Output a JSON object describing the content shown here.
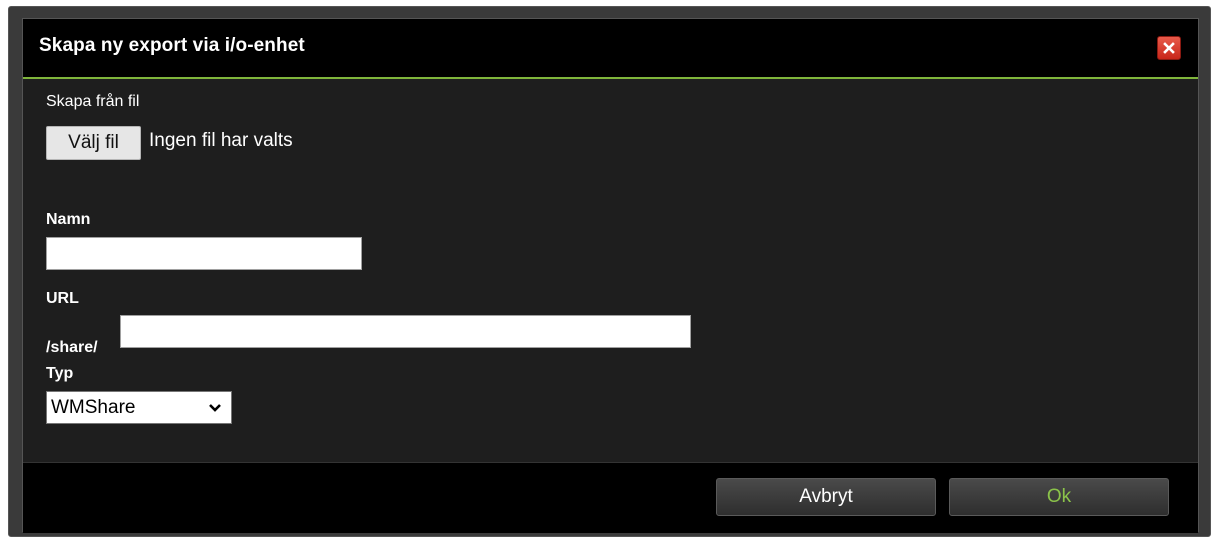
{
  "dialog": {
    "title": "Skapa ny export via i/o-enhet",
    "close_icon": "close-icon"
  },
  "form": {
    "from_file_label": "Skapa från fil",
    "file_button_label": "Välj fil",
    "file_status": "Ingen fil har valts",
    "name_label": "Namn",
    "name_value": "",
    "url_label": "URL",
    "url_prefix": "/share/",
    "url_value": "",
    "type_label": "Typ",
    "type_selected": "WMShare"
  },
  "footer": {
    "cancel_label": "Avbryt",
    "ok_label": "Ok"
  },
  "colors": {
    "accent": "#7fb53b",
    "ok_text": "#8bc34a",
    "close_red": "#d63a2c"
  }
}
